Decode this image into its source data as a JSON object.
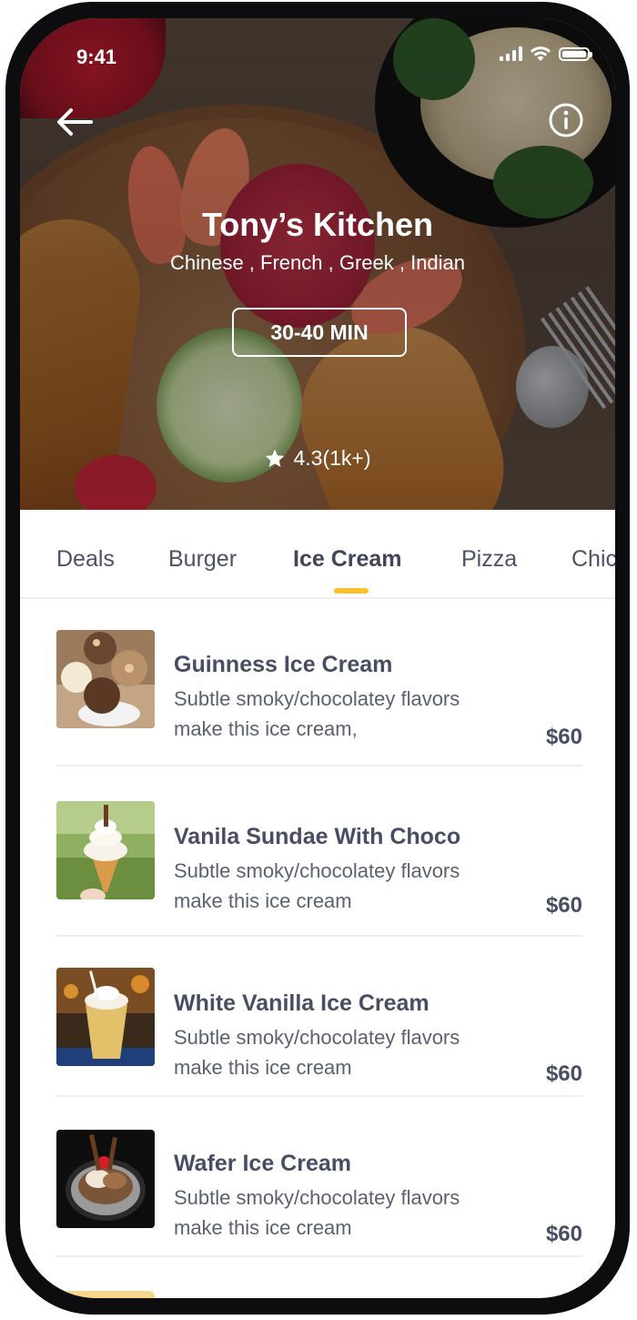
{
  "status_bar": {
    "time": "9:41"
  },
  "header": {
    "restaurant_name": "Tony’s Kitchen",
    "cuisines": "Chinese , French , Greek , Indian",
    "delivery_time": "30-40 MIN",
    "rating": "4.3(1k+)"
  },
  "tabs": [
    {
      "label": "Deals",
      "active": false
    },
    {
      "label": "Burger",
      "active": false
    },
    {
      "label": "Ice Cream",
      "active": true
    },
    {
      "label": "Pizza",
      "active": false
    },
    {
      "label": "Chic",
      "active": false
    }
  ],
  "items": [
    {
      "name": "Guinness Ice Cream",
      "desc1": "Subtle smoky/chocolatey flavors",
      "desc2": "make this ice cream,",
      "price": "$60",
      "image": "ice-cream-scoops"
    },
    {
      "name": "Vanila Sundae With Choco",
      "desc1": "Subtle smoky/chocolatey flavors",
      "desc2": "make this ice cream",
      "price": "$60",
      "image": "soft-serve-cone"
    },
    {
      "name": "White Vanilla Ice Cream",
      "desc1": "Subtle smoky/chocolatey flavors",
      "desc2": "make this ice cream",
      "price": "$60",
      "image": "ice-cream-cup"
    },
    {
      "name": "Wafer Ice Cream",
      "desc1": "Subtle smoky/chocolatey flavors",
      "desc2": "make this ice cream",
      "price": "$60",
      "image": "wafer-sundae"
    }
  ],
  "colors": {
    "accent": "#fbc02d",
    "text_dark": "#474e63",
    "text_muted": "#5b6172"
  }
}
